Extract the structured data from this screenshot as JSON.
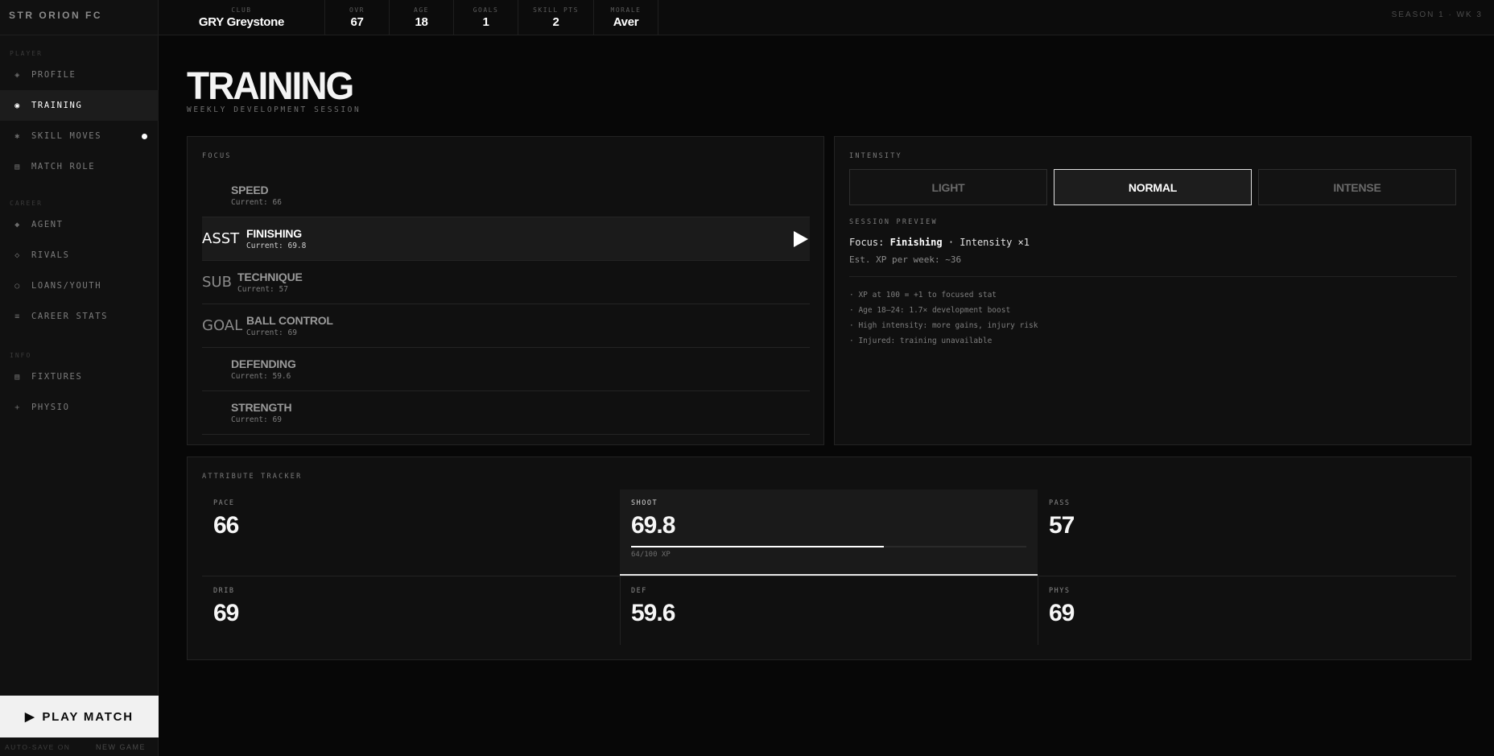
{
  "app": {
    "brand": "STR ORION FC"
  },
  "topbar": {
    "stats": [
      {
        "label": "CLUB",
        "value": "GRY Greystone"
      },
      {
        "label": "OVR",
        "value": "67"
      },
      {
        "label": "AGE",
        "value": "18"
      },
      {
        "label": "GOALS",
        "value": "1"
      },
      {
        "label": "SKILL PTS",
        "value": "2"
      },
      {
        "label": "MORALE",
        "value": "Aver"
      }
    ],
    "season": "SEASON 1 · WK 3"
  },
  "sidebar": {
    "sections": [
      {
        "label": "PLAYER",
        "items": [
          {
            "label": "PROFILE",
            "icon": "diamond-outline-icon",
            "glyph": "◈"
          },
          {
            "label": "TRAINING",
            "icon": "target-icon",
            "glyph": "◉",
            "active": true
          },
          {
            "label": "SKILL MOVES",
            "icon": "asterisk-icon",
            "glyph": "✱",
            "badge": true
          },
          {
            "label": "MATCH ROLE",
            "icon": "grid-icon",
            "glyph": "▤"
          }
        ]
      },
      {
        "label": "CAREER",
        "items": [
          {
            "label": "AGENT",
            "icon": "diamond-filled-icon",
            "glyph": "◆"
          },
          {
            "label": "RIVALS",
            "icon": "diamond-icon",
            "glyph": "◇"
          },
          {
            "label": "LOANS/YOUTH",
            "icon": "circle-icon",
            "glyph": "○"
          },
          {
            "label": "CAREER STATS",
            "icon": "list-icon",
            "glyph": "≡"
          }
        ]
      },
      {
        "label": "INFO",
        "items": [
          {
            "label": "FIXTURES",
            "icon": "calendar-icon",
            "glyph": "▤"
          },
          {
            "label": "PHYSIO",
            "icon": "plus-icon",
            "glyph": "+"
          }
        ]
      }
    ],
    "play_button": "PLAY MATCH",
    "footer": {
      "autosave": "AUTO-SAVE ON",
      "new_game": "NEW GAME"
    }
  },
  "page": {
    "title": "TRAINING",
    "subtitle": "WEEKLY DEVELOPMENT SESSION"
  },
  "focus": {
    "label": "FOCUS",
    "items": [
      {
        "tag": "",
        "name": "SPEED",
        "current": "Current: 66"
      },
      {
        "tag": "ASST",
        "name": "FINISHING",
        "current": "Current: 69.8",
        "active": true
      },
      {
        "tag": "SUB",
        "name": "TECHNIQUE",
        "current": "Current: 57"
      },
      {
        "tag": "GOAL",
        "name": "BALL CONTROL",
        "current": "Current: 69"
      },
      {
        "tag": "",
        "name": "DEFENDING",
        "current": "Current: 59.6"
      },
      {
        "tag": "",
        "name": "STRENGTH",
        "current": "Current: 69"
      }
    ]
  },
  "intensity": {
    "label": "INTENSITY",
    "options": [
      "LIGHT",
      "NORMAL",
      "INTENSE"
    ],
    "selected": "NORMAL",
    "preview_label": "SESSION PREVIEW",
    "preview_prefix": "Focus: ",
    "preview_focus": "Finishing",
    "preview_suffix": " · Intensity ×1",
    "est_xp": "Est. XP per week: ~36",
    "notes": [
      "· XP at 100 = +1 to focused stat",
      "· Age 18–24: 1.7× development boost",
      "· High intensity: more gains, injury risk",
      "· Injured: training unavailable"
    ]
  },
  "tracker": {
    "label": "ATTRIBUTE TRACKER",
    "attributes": [
      {
        "label": "PACE",
        "value": "66"
      },
      {
        "label": "SHOOT",
        "value": "69.8",
        "active": true,
        "xp_text": "64/100 XP",
        "xp_fraction": 0.64
      },
      {
        "label": "PASS",
        "value": "57"
      },
      {
        "label": "DRIB",
        "value": "69"
      },
      {
        "label": "DEF",
        "value": "59.6"
      },
      {
        "label": "PHYS",
        "value": "69"
      }
    ]
  }
}
